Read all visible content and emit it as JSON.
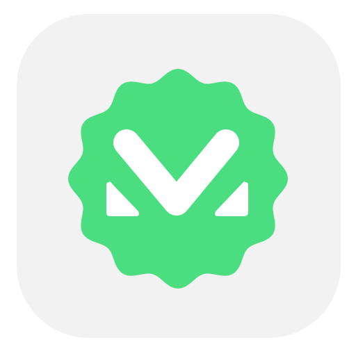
{
  "app_icon": {
    "icon": "verified-badge-v-icon",
    "colors": {
      "tile_background": "#f2f2f2",
      "badge": "#4ade80",
      "glyph": "#ffffff"
    }
  }
}
